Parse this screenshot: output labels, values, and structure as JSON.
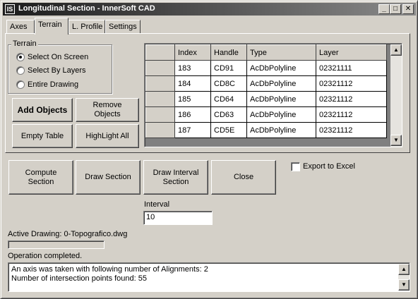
{
  "window": {
    "title": "Longitudinal Section - InnerSoft CAD",
    "icon_text": "IS",
    "controls": {
      "minimize": "_",
      "maximize": "□",
      "close": "✕"
    }
  },
  "tabs": [
    {
      "label": "Axes",
      "active": false
    },
    {
      "label": "Terrain",
      "active": true
    },
    {
      "label": "L. Profile",
      "active": false
    },
    {
      "label": "Settings",
      "active": false
    }
  ],
  "terrain_group": {
    "label": "Terrain",
    "options": [
      {
        "label": "Select On Screen",
        "checked": true
      },
      {
        "label": "Select By Layers",
        "checked": false
      },
      {
        "label": "Entire Drawing",
        "checked": false
      }
    ]
  },
  "buttons": {
    "add_objects": "Add Objects",
    "remove_objects": "Remove Objects",
    "empty_table": "Empty Table",
    "highlight_all": "HighLight All",
    "compute_section": "Compute Section",
    "draw_section": "Draw Section",
    "draw_interval_section": "Draw Interval Section",
    "close": "Close"
  },
  "grid": {
    "columns": [
      "Index",
      "Handle",
      "Type",
      "Layer"
    ],
    "rows": [
      [
        "183",
        "CD91",
        "AcDbPolyline",
        "02321111"
      ],
      [
        "184",
        "CD8C",
        "AcDbPolyline",
        "02321112"
      ],
      [
        "185",
        "CD64",
        "AcDbPolyline",
        "02321112"
      ],
      [
        "186",
        "CD63",
        "AcDbPolyline",
        "02321112"
      ],
      [
        "187",
        "CD5E",
        "AcDbPolyline",
        "02321112"
      ]
    ]
  },
  "export": {
    "label": "Export to Excel",
    "checked": false
  },
  "interval": {
    "label": "Interval",
    "value": "10"
  },
  "status": {
    "active_drawing": "Active Drawing: 0-Topografico.dwg",
    "progress": 0,
    "operation": "Operation completed."
  },
  "log": {
    "lines": [
      "An axis was taken with following number of Alignments: 2",
      "Number of intersection points found: 55"
    ]
  },
  "scroll_glyphs": {
    "up": "▲",
    "down": "▼"
  }
}
